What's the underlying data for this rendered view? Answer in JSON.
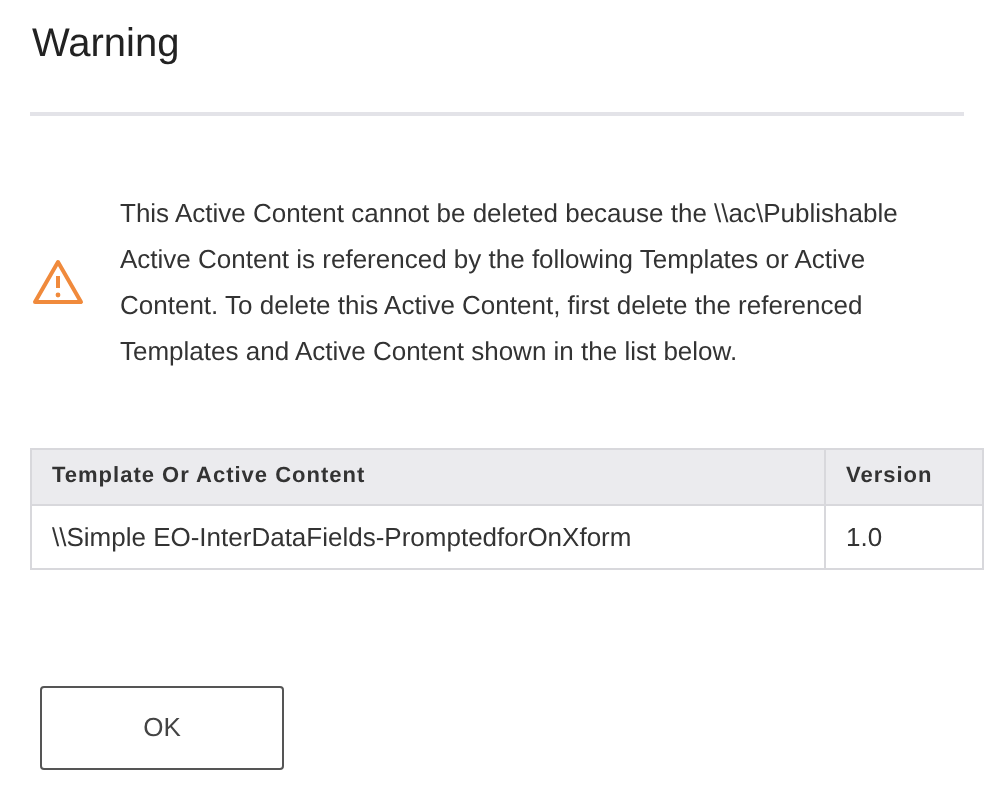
{
  "dialog": {
    "title": "Warning",
    "message": "This Active Content cannot be deleted because the \\\\ac\\Publishable Active Content is referenced by the following Templates or Active Content. To delete this Active Content, first delete the referenced Templates and Active Content shown in the list below.",
    "table": {
      "columns": [
        "Template Or Active Content",
        "Version"
      ],
      "rows": [
        [
          "\\\\Simple EO-InterDataFields-PromptedforOnXform",
          "1.0"
        ]
      ]
    },
    "buttons": [
      "OK"
    ]
  }
}
